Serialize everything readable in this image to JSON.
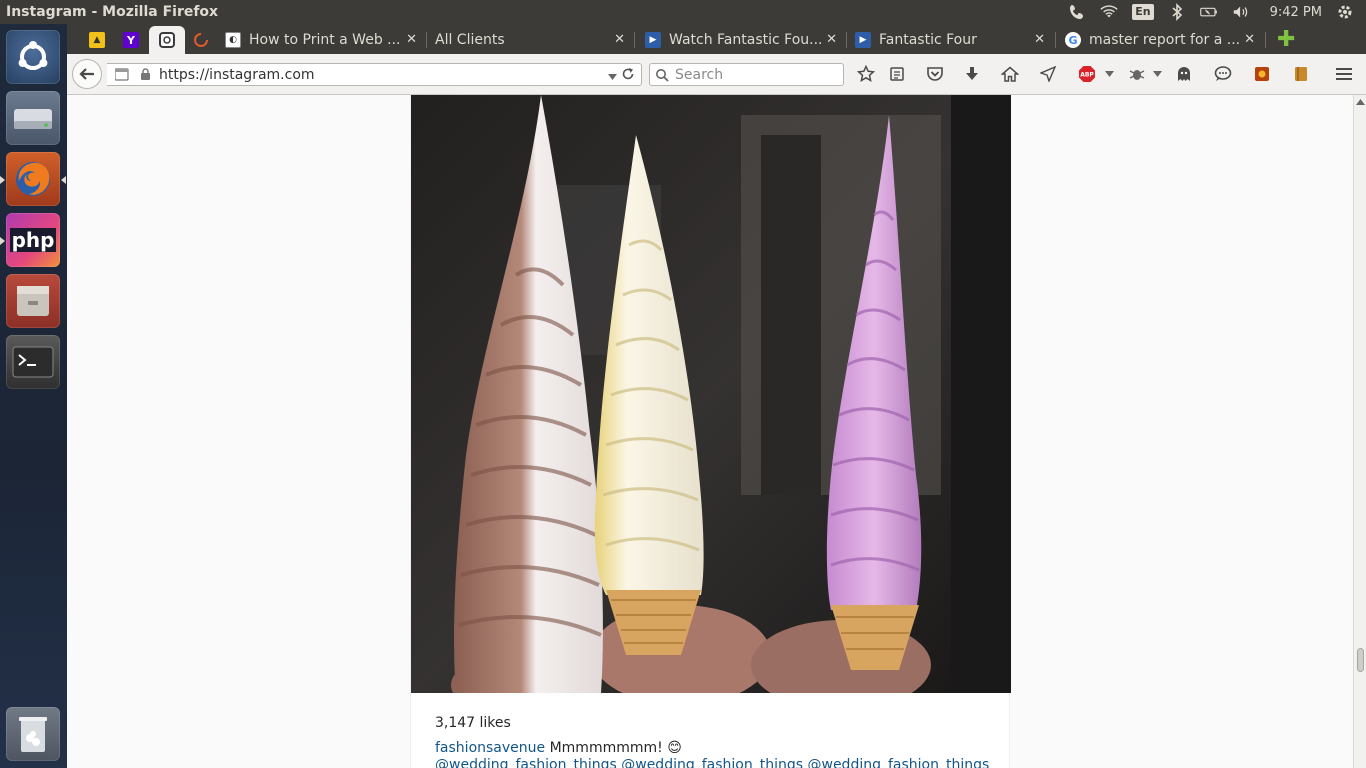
{
  "window": {
    "title": "Instagram - Mozilla Firefox"
  },
  "tray": {
    "keyboard": "En",
    "clock": "9:42 PM"
  },
  "launcher": {
    "items": [
      "ubuntu-dash",
      "disk-drive",
      "firefox",
      "phpstorm",
      "file-manager",
      "terminal",
      "trash"
    ]
  },
  "tabs": [
    {
      "label": "",
      "icon": "warning-favicon"
    },
    {
      "label": "",
      "icon": "yahoo-favicon"
    },
    {
      "label": "",
      "icon": "instagram-favicon",
      "active": true
    },
    {
      "label": "",
      "icon": "loading-favicon"
    },
    {
      "label": "How to Print a Web ...",
      "icon": "wikihow-favicon"
    },
    {
      "label": "All Clients",
      "icon": ""
    },
    {
      "label": "Watch Fantastic Fou...",
      "icon": "movie-favicon"
    },
    {
      "label": "Fantastic Four",
      "icon": "movie-favicon"
    },
    {
      "label": "master report for a ...",
      "icon": "google-favicon"
    }
  ],
  "nav": {
    "url": "https://instagram.com",
    "search_placeholder": "Search"
  },
  "post": {
    "likes": "3,147 likes",
    "username": "fashionsavenue",
    "caption": "Mmmmmmmm! 😊",
    "tags": "@wedding_fashion_things @wedding_fashion_things @wedding_fashion_things"
  },
  "colors": {
    "accent_link": "#125688",
    "chrome_dark": "#3c3b37",
    "chrome_light": "#f2f1f0"
  }
}
